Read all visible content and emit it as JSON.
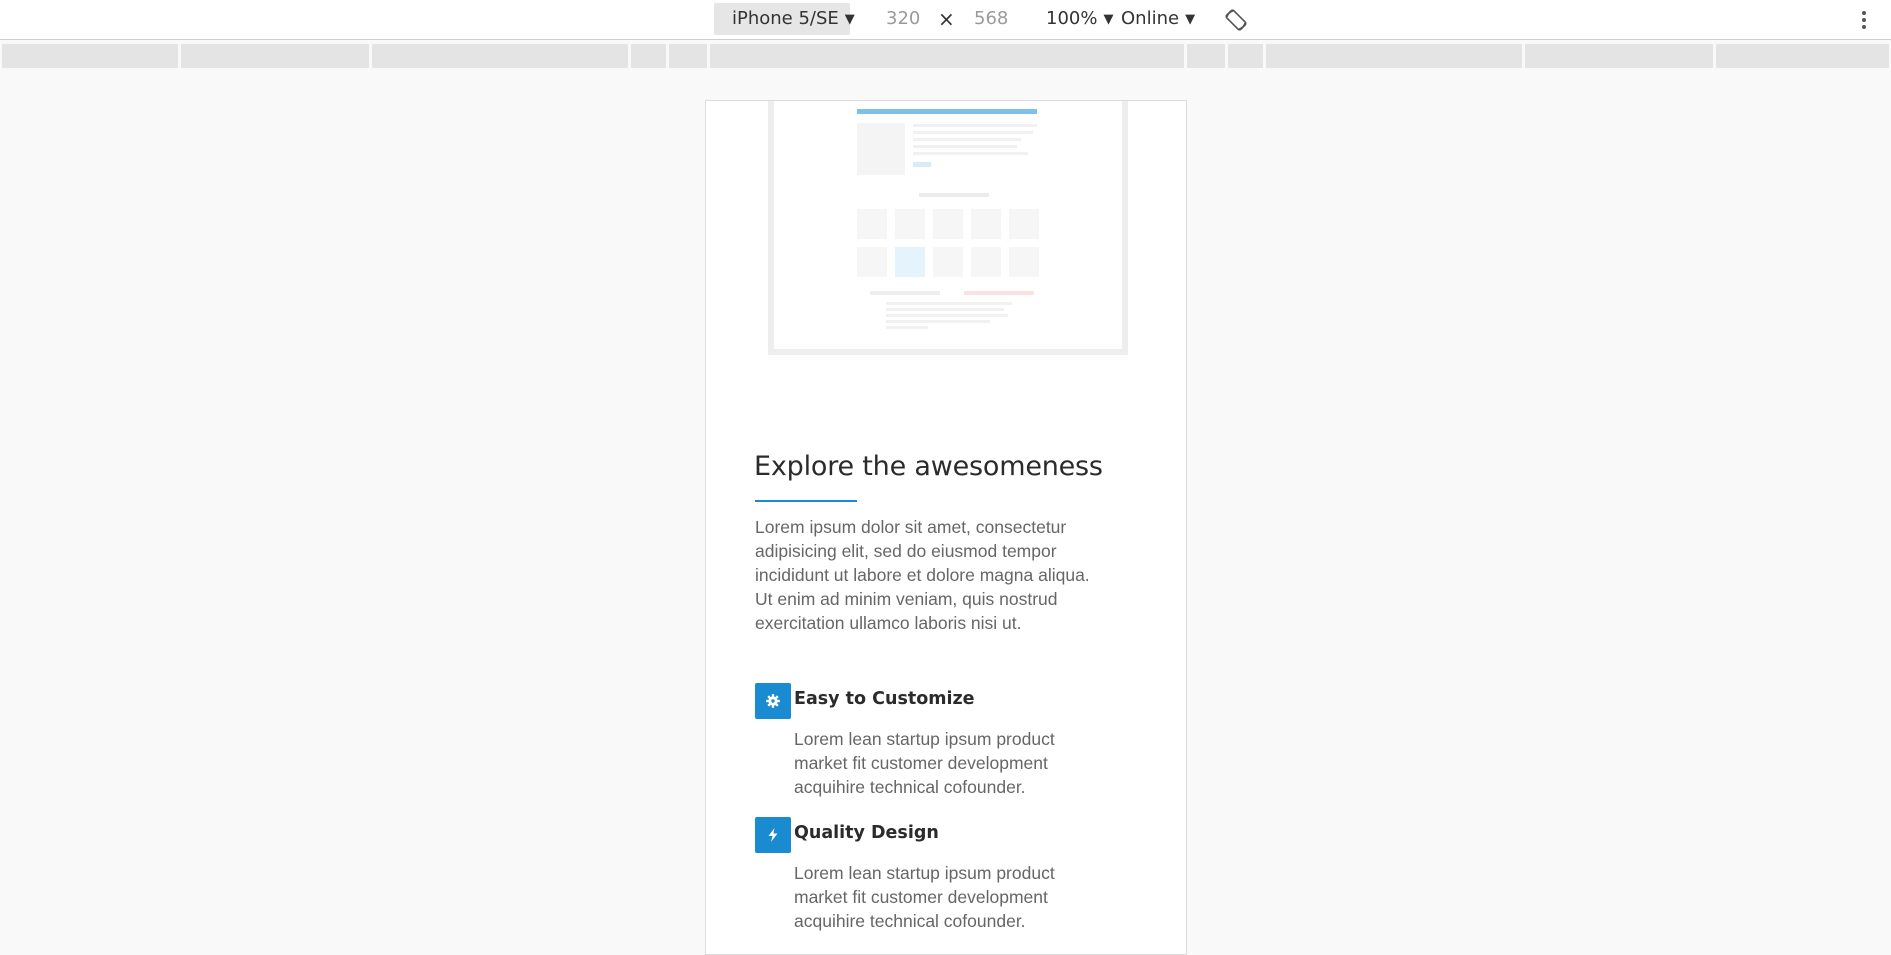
{
  "toolbar": {
    "device": "iPhone 5/SE",
    "caret": "▼",
    "width": "320",
    "times": "×",
    "height": "568",
    "zoom": "100%",
    "throttling": "Online",
    "icons": [
      "rotate-icon",
      "more-options-icon"
    ]
  },
  "page": {
    "section_title": "Explore the awesomeness",
    "intro": "Lorem ipsum dolor sit amet, consectetur adipisicing elit, sed do eiusmod tempor incididunt ut labore et dolore magna aliqua. Ut enim ad minim veniam, quis nostrud exercitation ullamco laboris nisi ut.",
    "features": [
      {
        "icon": "gear-icon",
        "title": "Easy to Customize",
        "text": "Lorem lean startup ipsum product market fit customer development acquihire technical cofounder."
      },
      {
        "icon": "bolt-icon",
        "title": "Quality Design",
        "text": "Lorem lean startup ipsum product market fit customer development acquihire technical cofounder."
      }
    ]
  },
  "colors": {
    "accent": "#1a8ad1",
    "toolbar_bg": "#ffffff",
    "page_bg": "#f9f9f9",
    "text": "#666666"
  }
}
